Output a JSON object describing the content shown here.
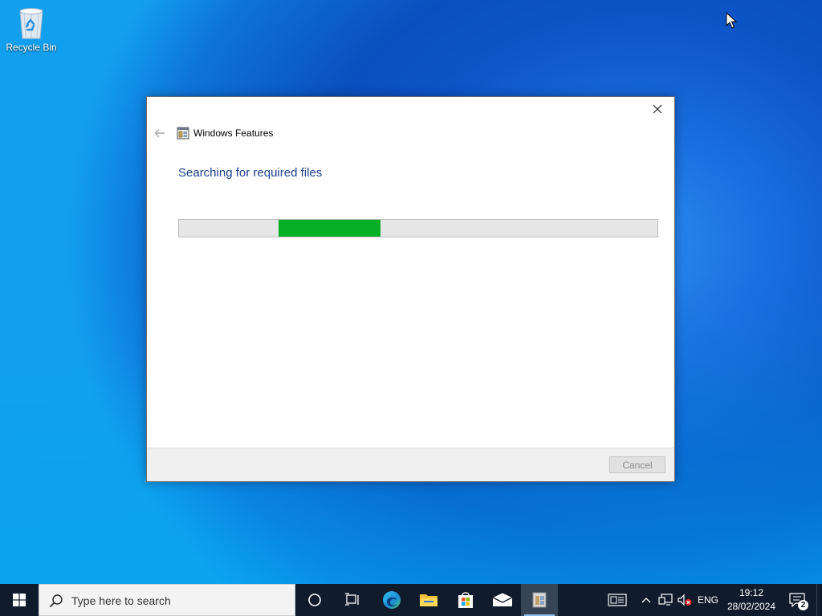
{
  "desktop": {
    "icons": [
      {
        "label": "Recycle Bin",
        "icon": "recycle-bin-icon"
      }
    ]
  },
  "dialog": {
    "title": "Windows Features",
    "status_heading": "Searching for required files",
    "progress": {
      "mode": "indeterminate",
      "color": "#06b025"
    },
    "cancel_label": "Cancel",
    "cancel_enabled": false,
    "icons": {
      "back": "back-arrow-icon",
      "app": "windows-features-icon",
      "close": "close-icon"
    }
  },
  "taskbar": {
    "search_placeholder": "Type here to search",
    "pinned": [
      {
        "name": "cortana",
        "icon": "cortana-circle-icon"
      },
      {
        "name": "task-view",
        "icon": "task-view-icon"
      },
      {
        "name": "edge",
        "icon": "edge-icon"
      },
      {
        "name": "file-explorer",
        "icon": "folder-icon"
      },
      {
        "name": "microsoft-store",
        "icon": "store-bag-icon"
      },
      {
        "name": "mail",
        "icon": "mail-envelope-icon"
      },
      {
        "name": "windows-features",
        "icon": "windows-features-icon",
        "active": true
      }
    ],
    "tray": {
      "language": "ENG",
      "time": "19:12",
      "date": "28/02/2024",
      "notification_count": "2",
      "icons": [
        "news-widget-icon",
        "chevron-up-icon",
        "network-icon",
        "volume-muted-icon",
        "action-center-icon"
      ]
    }
  },
  "colors": {
    "accent_heading": "#1b3f8b",
    "taskbar": "#101c2c",
    "progress_green": "#06b025"
  }
}
